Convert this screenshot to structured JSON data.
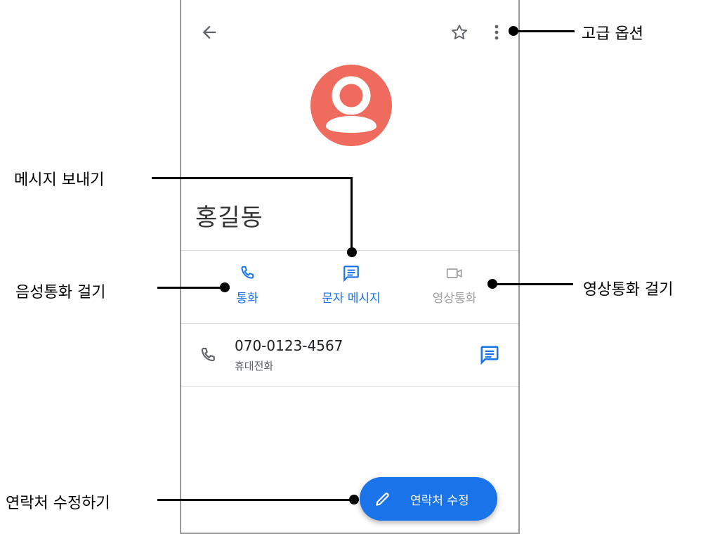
{
  "app": {
    "contact_name": "홍길동",
    "icons": {
      "back": "arrow-back-icon",
      "star": "star-outline-icon",
      "more": "more-vert-icon",
      "avatar": "person-icon",
      "call": "phone-icon",
      "message": "message-icon",
      "video": "videocam-icon",
      "edit": "pencil-icon"
    },
    "actions": {
      "call_label": "통화",
      "message_label": "문자 메시지",
      "video_label": "영상통화"
    },
    "phone_entry": {
      "number": "070-0123-4567",
      "type": "휴대전화"
    },
    "fab": {
      "label": "연락처 수정"
    }
  },
  "annotations": {
    "more_options": "고급 옵션",
    "send_message": "메시지 보내기",
    "voice_call": "음성통화 걸기",
    "video_call": "영상통화 걸기",
    "edit_contact": "연락처 수정하기"
  },
  "colors": {
    "accent": "#1a73e8",
    "avatar": "#ee6b5d",
    "disabled": "#9e9e9e"
  }
}
